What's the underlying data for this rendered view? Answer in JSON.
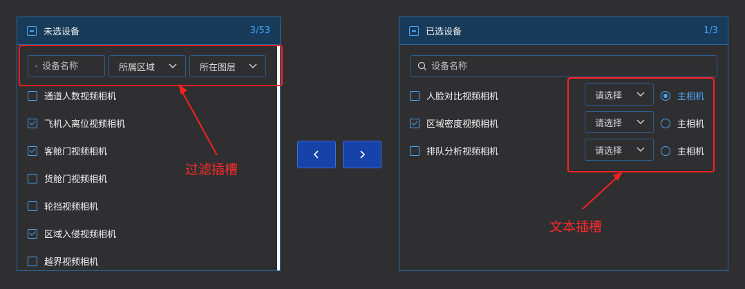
{
  "left_panel": {
    "title": "未选设备",
    "count": "3/53",
    "search_placeholder": "设备名称",
    "filters": [
      {
        "label": "所属区域"
      },
      {
        "label": "所在图层"
      }
    ],
    "items": [
      {
        "label": "通道人数视频相机",
        "checked": false
      },
      {
        "label": "飞机入离位视频相机",
        "checked": true
      },
      {
        "label": "客舱门视频相机",
        "checked": true
      },
      {
        "label": "货舱门视频相机",
        "checked": false
      },
      {
        "label": "轮挡视频相机",
        "checked": false
      },
      {
        "label": "区域入侵视频相机",
        "checked": true
      },
      {
        "label": "越界视频相机",
        "checked": false
      }
    ]
  },
  "transfer_buttons": {
    "left_icon": "chevron-left-icon",
    "right_icon": "chevron-right-icon"
  },
  "right_panel": {
    "title": "已选设备",
    "count": "1/3",
    "search_placeholder": "设备名称",
    "items": [
      {
        "label": "人脸对比视频相机",
        "checked": false,
        "select_placeholder": "请选择",
        "radio_label": "主相机",
        "radio_selected": true
      },
      {
        "label": "区域密度视频相机",
        "checked": true,
        "select_placeholder": "请选择",
        "radio_label": "主相机",
        "radio_selected": false
      },
      {
        "label": "排队分析视频相机",
        "checked": false,
        "select_placeholder": "请选择",
        "radio_label": "主相机",
        "radio_selected": false
      }
    ]
  },
  "annotations": {
    "filter_slot": "过滤插槽",
    "text_slot": "文本插槽"
  },
  "colors": {
    "accent": "#48a6f5",
    "border": "#2a6ba3",
    "header_bg": "#183b5a",
    "button_bg": "#1743a8",
    "annotation": "#ff2020"
  }
}
